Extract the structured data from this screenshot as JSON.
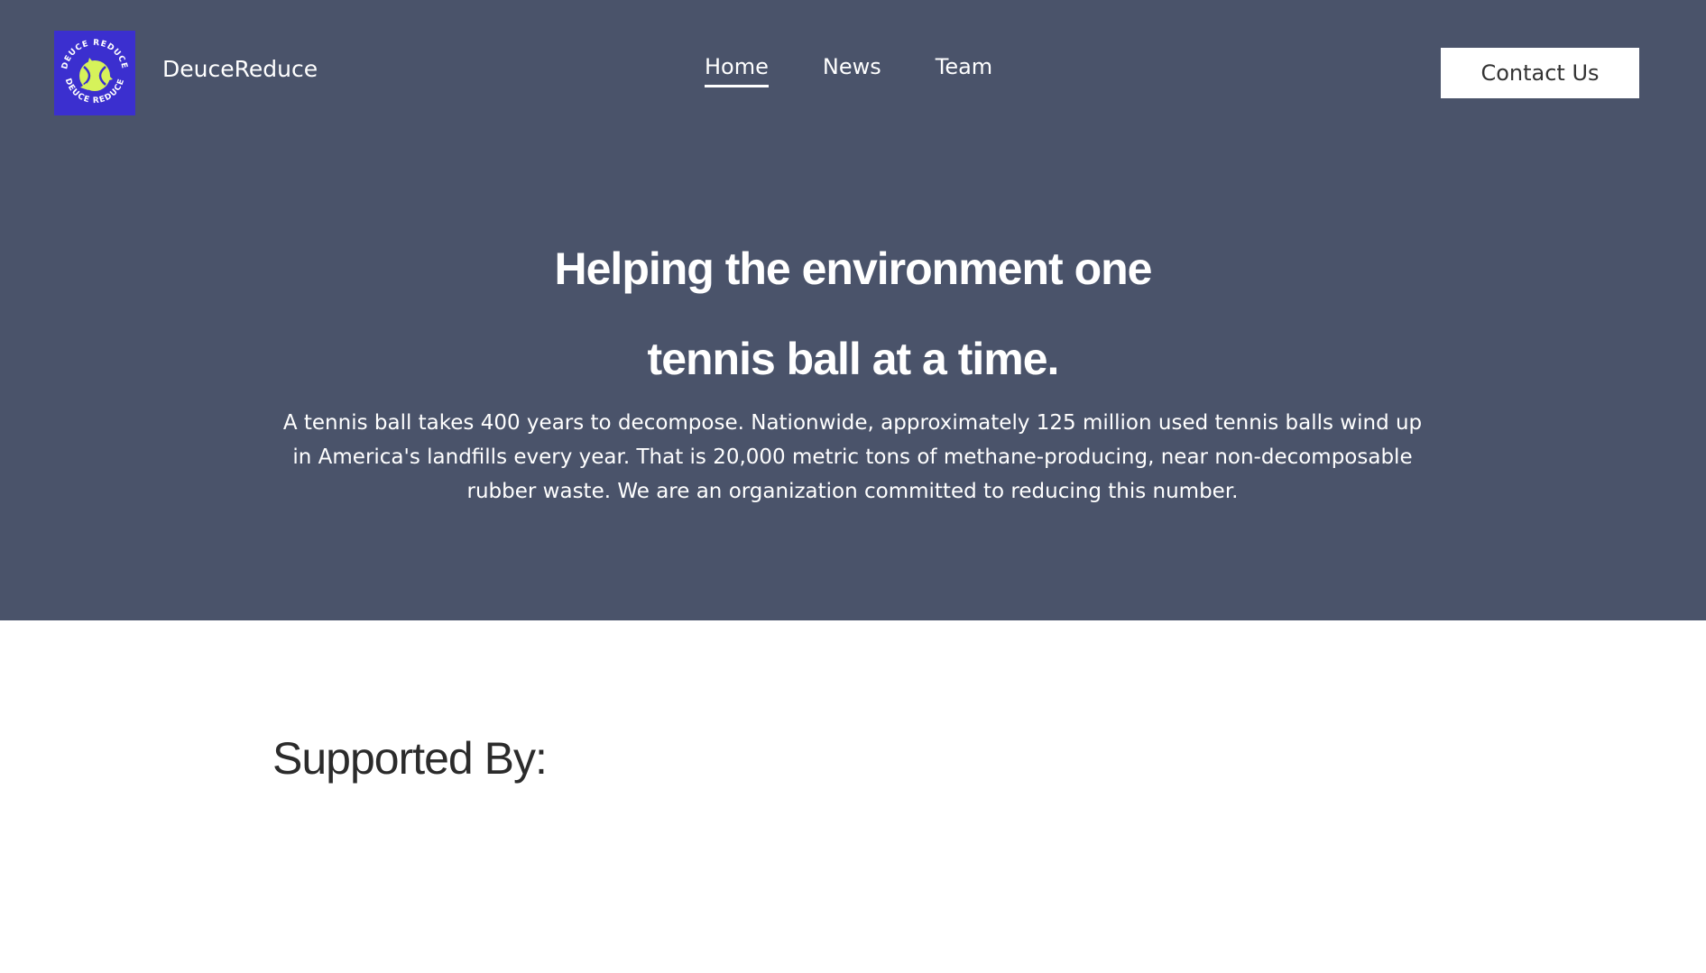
{
  "header": {
    "logo": {
      "ring_text_top": "DEUCE REDUCE",
      "ring_text_bottom": "DEUCE REDUCE",
      "icon": "recycle-tennis-ball-icon",
      "background_color": "#3b2fcf",
      "accent_color": "#d6f25a"
    },
    "brand_name": "DeuceReduce",
    "nav": [
      {
        "label": "Home",
        "active": true
      },
      {
        "label": "News",
        "active": false
      },
      {
        "label": "Team",
        "active": false
      }
    ],
    "contact_label": "Contact Us"
  },
  "hero": {
    "headline_line1": "Helping the environment one",
    "headline_line2": "tennis ball at a time.",
    "description": "A tennis ball takes 400 years to decompose. Nationwide, approximately 125 million used tennis balls wind up in America's landfills every year. That is 20,000 metric tons of methane-producing, near non-decomposable rubber waste. We are an organization committed to reducing this number.",
    "background_color": "#4a536a"
  },
  "supported": {
    "heading": "Supported By:"
  }
}
